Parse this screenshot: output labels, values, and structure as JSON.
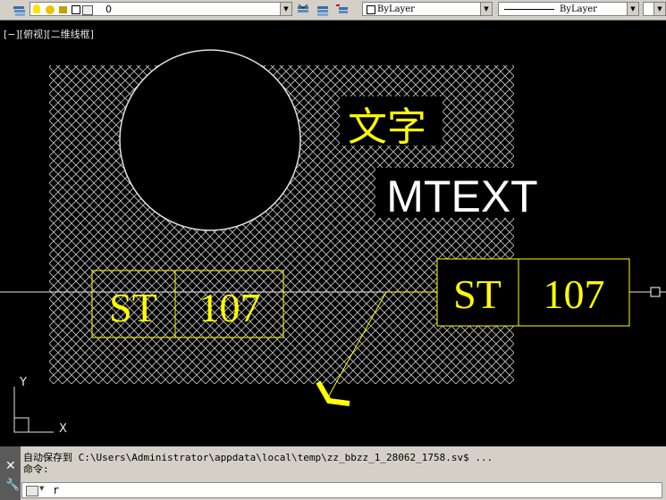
{
  "toolbar": {
    "layer_value": "0",
    "color_label": "ByLayer",
    "linetype_label": "ByLayer"
  },
  "viewport": {
    "label": "[−][俯视][二维线框]"
  },
  "drawing": {
    "chinese_text": "文字",
    "mtext": "MTEXT",
    "block_left": {
      "a": "ST",
      "b": "107"
    },
    "block_right": {
      "a": "ST",
      "b": "107"
    },
    "ucs_x": "X",
    "ucs_y": "Y",
    "colors": {
      "yellow": "#ffff00",
      "white": "#ffffff",
      "hatch": "#bfbfbf"
    }
  },
  "command": {
    "history_line1": "自动保存到 C:\\Users\\Administrator\\appdata\\local\\temp\\zz_bbzz_1_28062_1758.sv$ ...",
    "history_line2": "命令:",
    "input_value": "r"
  }
}
